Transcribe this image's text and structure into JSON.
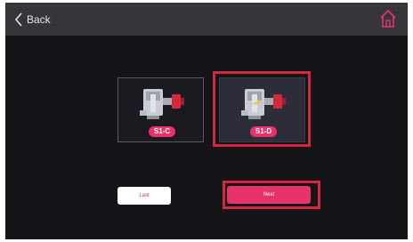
{
  "header": {
    "back_label": "Back",
    "back_icon": "chevron-left-icon",
    "home_icon": "home-icon"
  },
  "options": [
    {
      "label": "S1-C",
      "selected": false
    },
    {
      "label": "S1-D",
      "selected": true
    }
  ],
  "buttons": {
    "last_label": "Last",
    "next_label": "Next"
  },
  "colors": {
    "background": "#141419",
    "topbar": "#35353b",
    "accent": "#e7326a",
    "highlight": "#d4283e"
  }
}
